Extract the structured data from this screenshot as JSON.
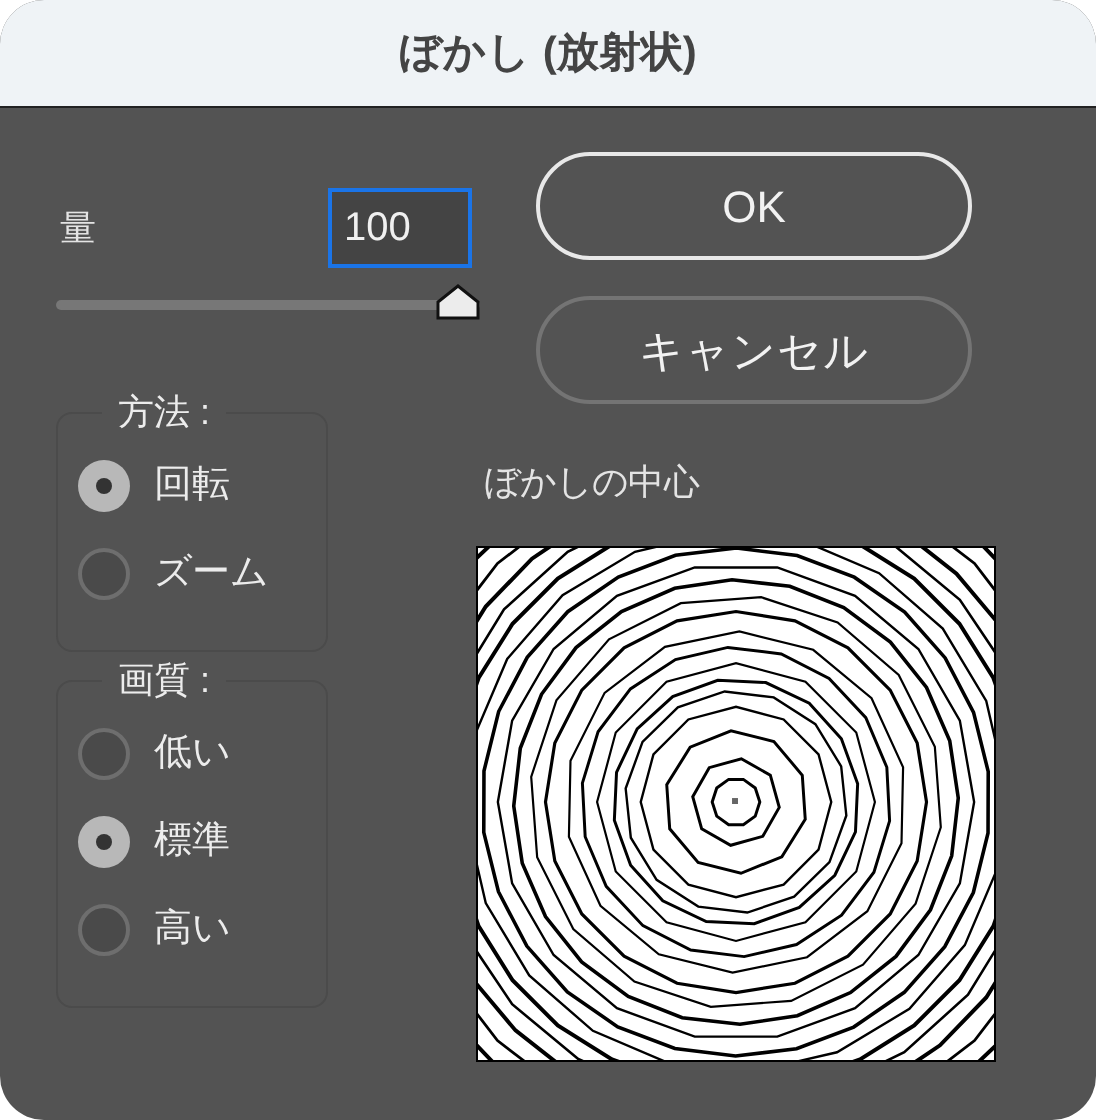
{
  "window": {
    "title": "ぼかし (放射状)"
  },
  "amount": {
    "label": "量",
    "value": "100",
    "level": 1
  },
  "buttons": [
    {
      "label": "OK",
      "kind": "default"
    },
    {
      "label": "キャンセル",
      "kind": "normal"
    }
  ],
  "groups": [
    {
      "title": "方法 :",
      "options": [
        {
          "label": "回転",
          "selected": true
        },
        {
          "label": "ズーム",
          "selected": false
        }
      ]
    },
    {
      "title": "画質 :",
      "options": [
        {
          "label": "低い",
          "selected": false
        },
        {
          "label": "標準",
          "selected": true
        },
        {
          "label": "高い",
          "selected": false
        }
      ]
    }
  ],
  "preview": {
    "label": "ぼかしの中心"
  }
}
